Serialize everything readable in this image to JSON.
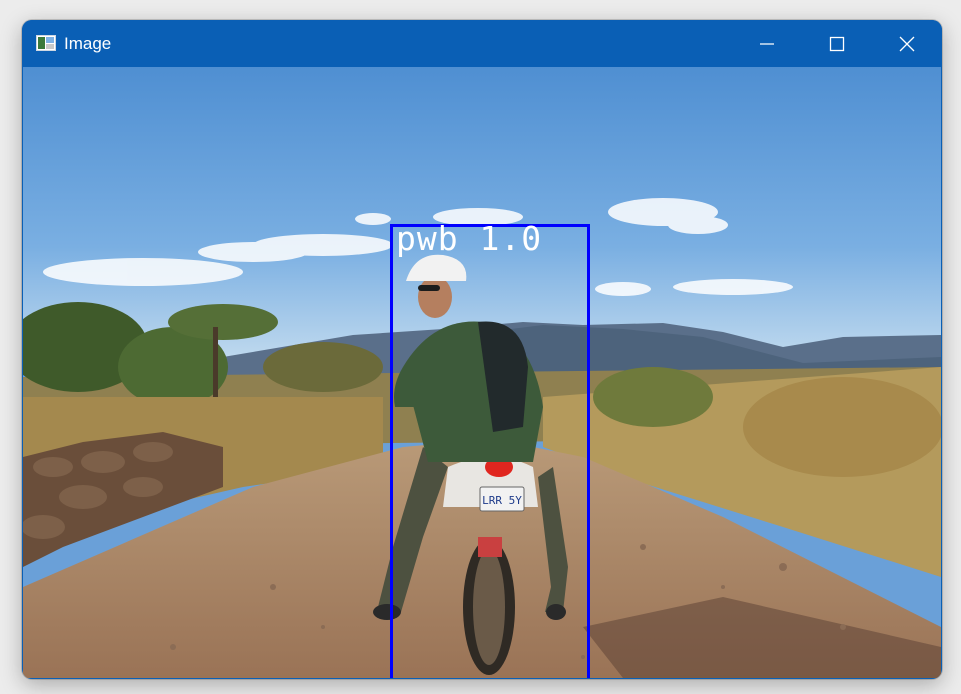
{
  "window": {
    "title": "Image",
    "controls": {
      "minimize": "minimize-icon",
      "maximize": "maximize-icon",
      "close": "close-icon"
    },
    "titlebar_color": "#0a5fb5"
  },
  "detection": {
    "label": "pwb 1.0",
    "box_color": "#0000ff",
    "label_color": "#ffffff"
  },
  "image": {
    "license_plate": "LRR 5Y"
  }
}
